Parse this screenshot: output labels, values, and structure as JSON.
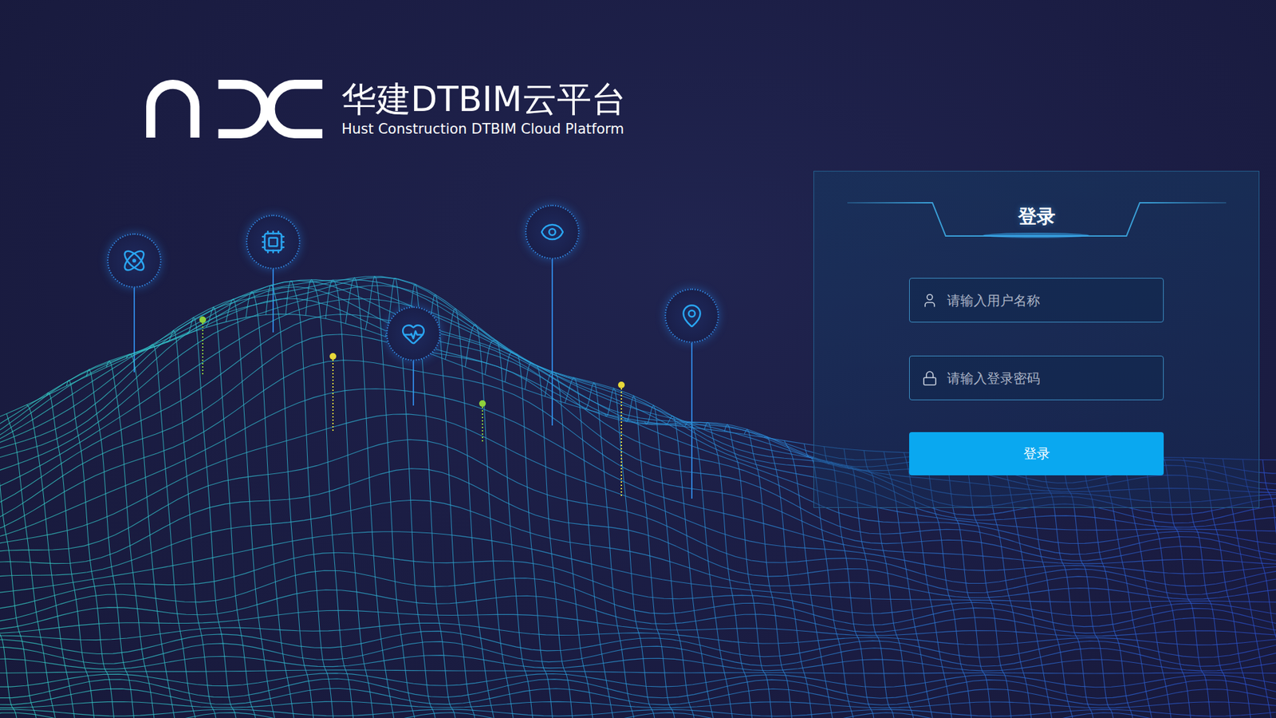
{
  "logo": {
    "title": "华建DTBIM云平台",
    "subtitle": "Hust Construction DTBIM Cloud Platform"
  },
  "login": {
    "title": "登录",
    "fields": [
      {
        "placeholder": "请输入用户名称",
        "kind": "user"
      },
      {
        "placeholder": "请输入登录密码",
        "kind": "password"
      }
    ],
    "button": "登录"
  }
}
